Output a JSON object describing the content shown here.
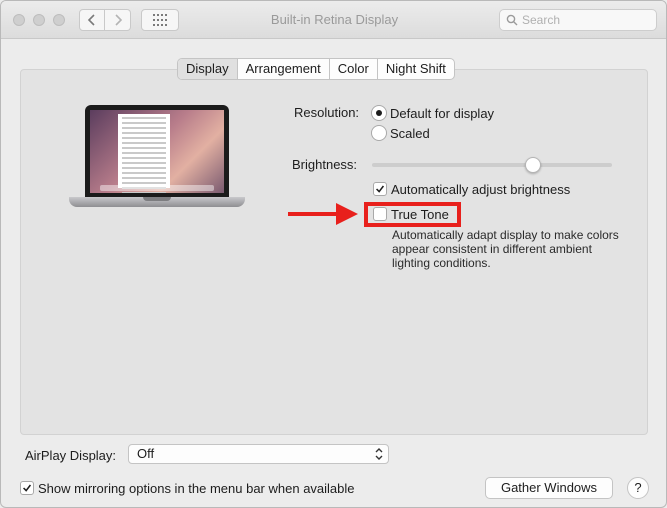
{
  "window": {
    "title": "Built-in Retina Display"
  },
  "search": {
    "placeholder": "Search"
  },
  "tabs": [
    {
      "label": "Display",
      "active": true
    },
    {
      "label": "Arrangement",
      "active": false
    },
    {
      "label": "Color",
      "active": false
    },
    {
      "label": "Night Shift",
      "active": false
    }
  ],
  "resolution": {
    "label": "Resolution:",
    "options": [
      {
        "label": "Default for display",
        "selected": true
      },
      {
        "label": "Scaled",
        "selected": false
      }
    ]
  },
  "brightness": {
    "label": "Brightness:",
    "level": 0.67,
    "auto_adjust": {
      "label": "Automatically adjust brightness",
      "checked": true
    }
  },
  "true_tone": {
    "label": "True Tone",
    "checked": false,
    "description": "Automatically adapt display to make colors appear consistent in different ambient lighting conditions.",
    "highlight_color": "#e8201c"
  },
  "airplay": {
    "label": "AirPlay Display:",
    "value": "Off"
  },
  "mirroring": {
    "label": "Show mirroring options in the menu bar when available",
    "checked": true
  },
  "buttons": {
    "gather_windows": "Gather Windows",
    "help": "?"
  },
  "icons": [
    "back-icon",
    "forward-icon",
    "grid-icon",
    "search-icon",
    "chevron-updown-icon",
    "arrow-icon"
  ]
}
